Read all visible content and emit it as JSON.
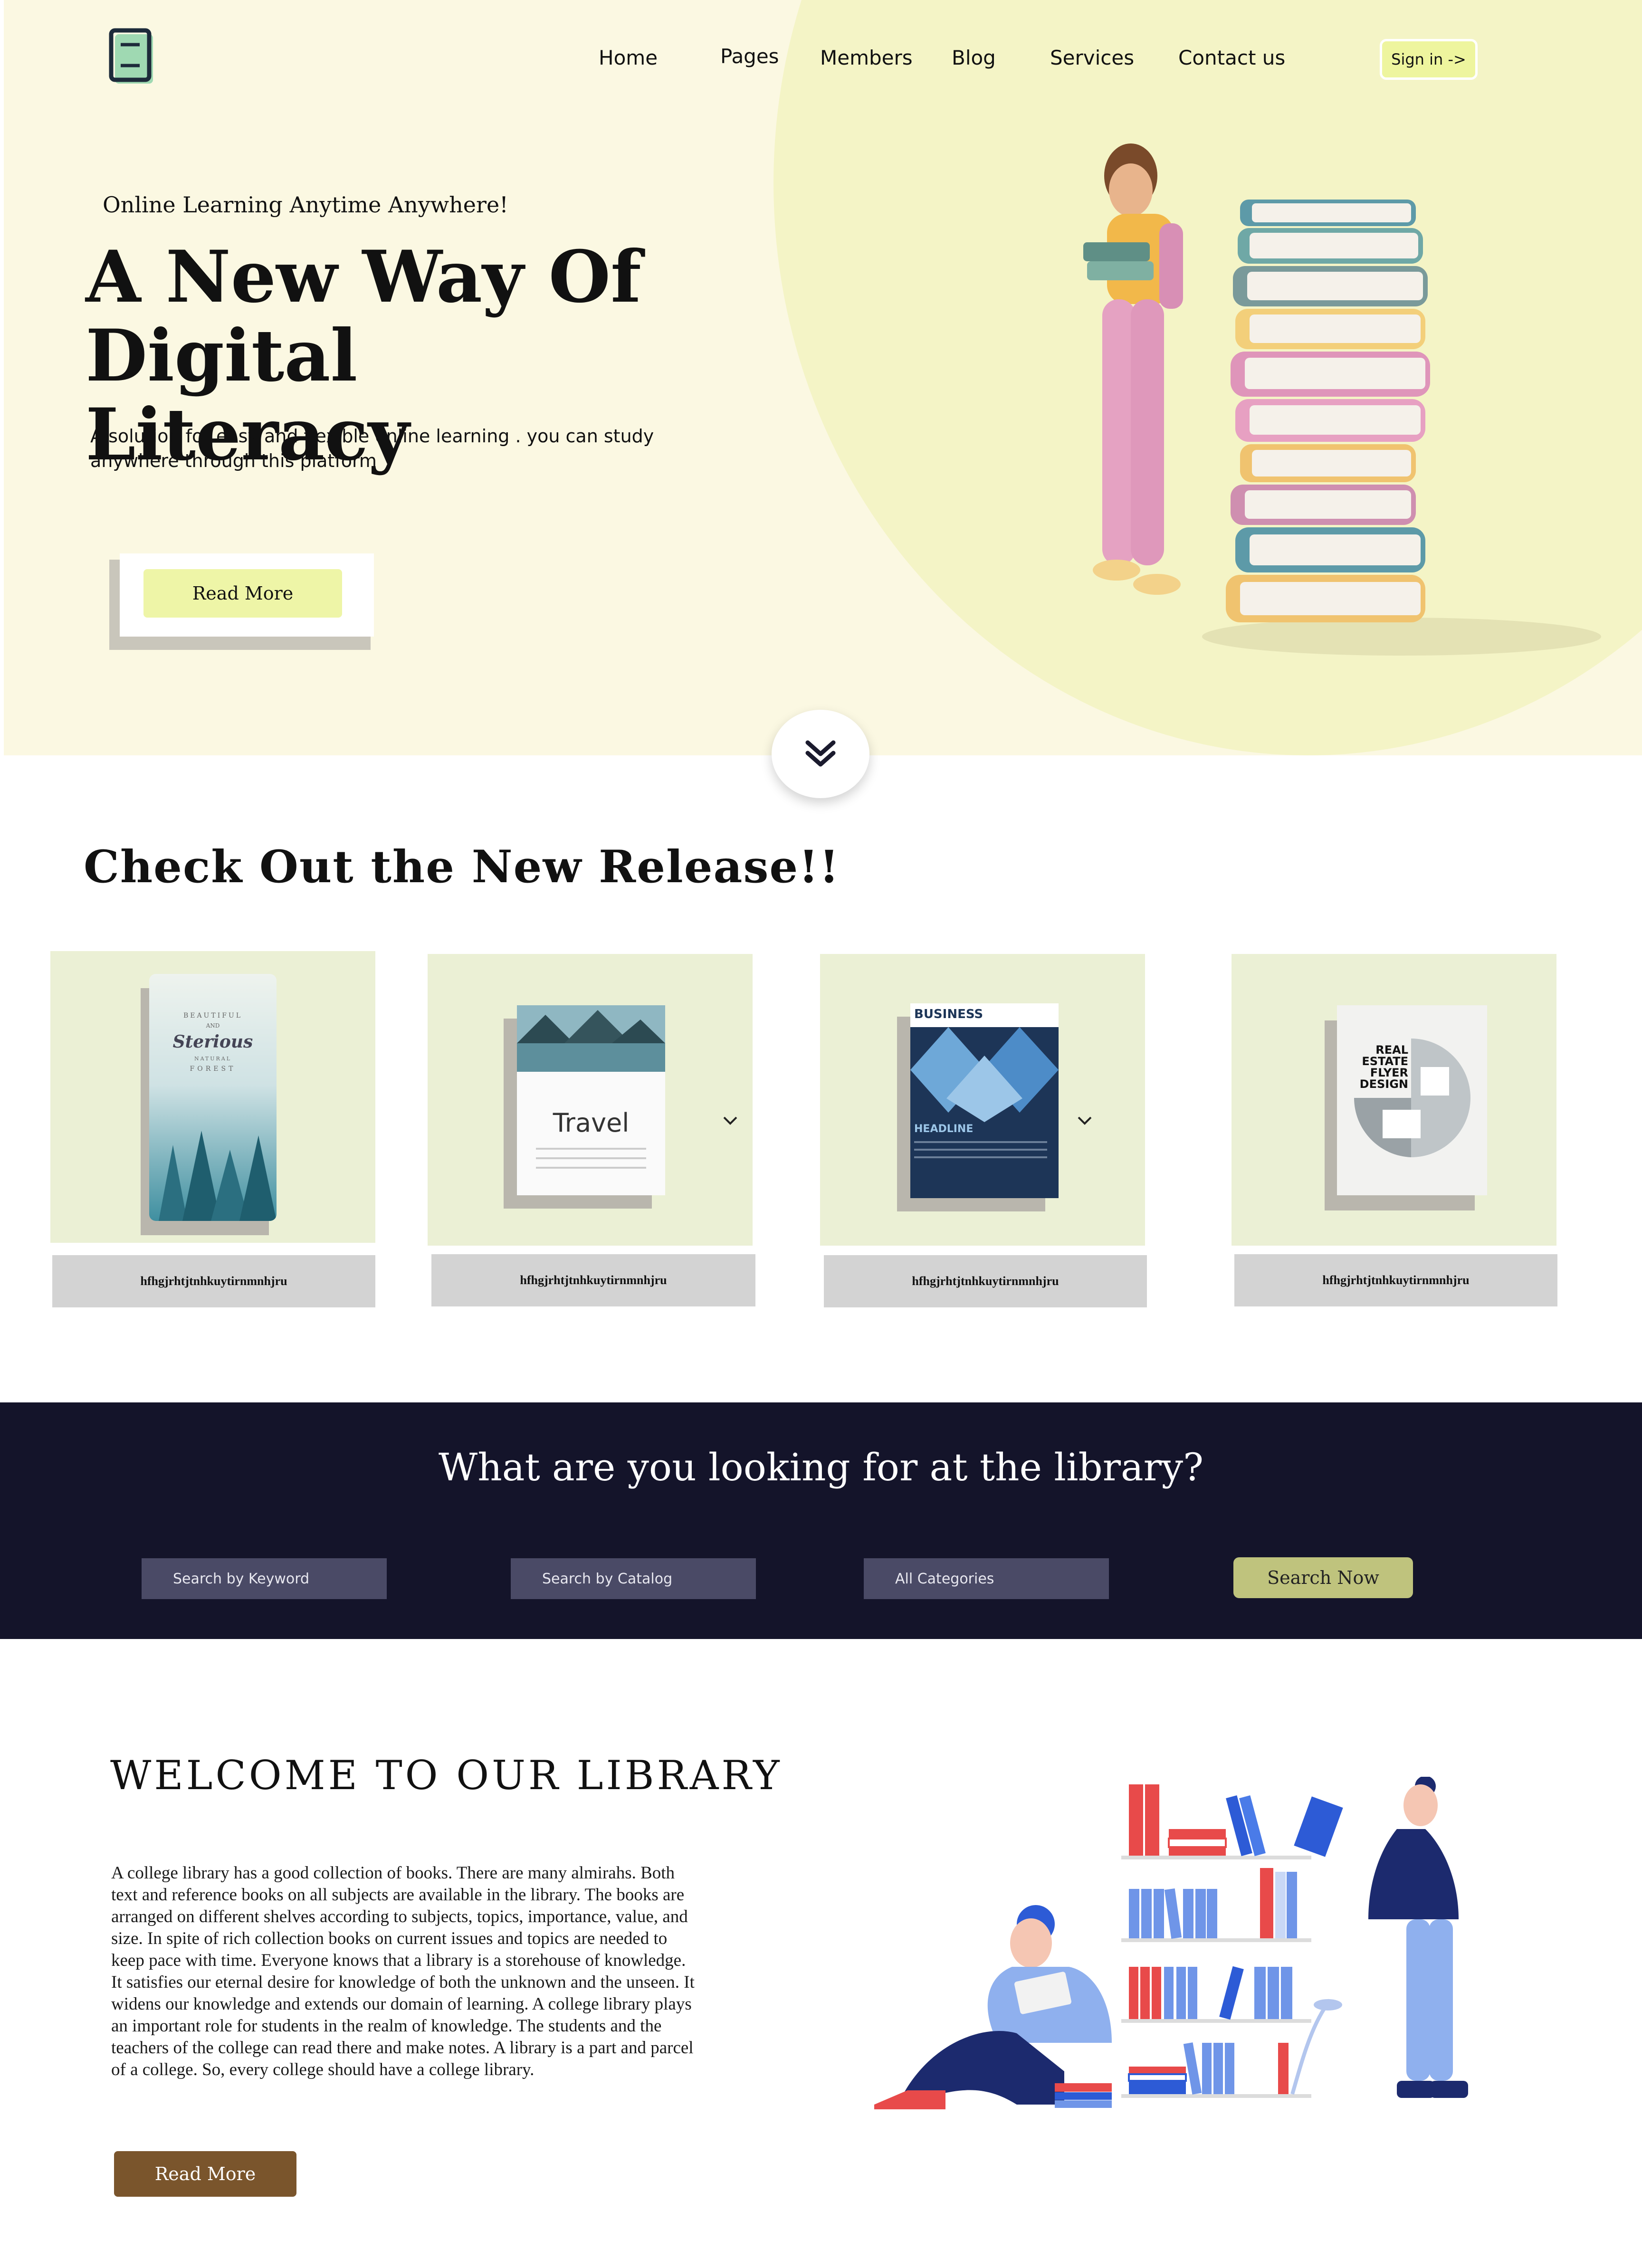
{
  "nav": {
    "logo_icon": "book-logo-icon",
    "links": [
      "Home",
      "Pages",
      "Members",
      "Blog",
      "Services",
      "Contact us"
    ],
    "signin_label": "Sign in ->"
  },
  "hero": {
    "tagline": "Online Learning Anytime Anywhere!",
    "title": "A New Way  Of\nDigital Literacy",
    "description": "A solution for easy and flexible online learning . you can study anywhere through this platform",
    "read_more_label": "Read More",
    "scroll_icon": "double-chevron-down-icon"
  },
  "release": {
    "title": "Check Out the New Release!!",
    "books": [
      {
        "cover_line1": "BEAUTIFUL",
        "cover_line2": "AND",
        "cover_title": "Sterious",
        "cover_line3": "NATURAL",
        "cover_line4": "FOREST",
        "caption": "hfhgjrhtjtnhkuytirnmnhjru"
      },
      {
        "cover_title": "Travel",
        "caption": "hfhgjrhtjtnhkuytirnmnhjru"
      },
      {
        "cover_title": "BUSINESS",
        "cover_sub": "HEADLINE",
        "caption": "hfhgjrhtjtnhkuytirnmnhjru"
      },
      {
        "cover_title": "REAL ESTATE FLYER DESIGN",
        "caption": "hfhgjrhtjtnhkuytirnmnhjru"
      }
    ]
  },
  "search": {
    "heading": "What are you looking for at the library?",
    "keyword_placeholder": "Search by Keyword",
    "catalog_placeholder": "Search by Catalog",
    "category_value": "All Categories",
    "button_label": "Search Now"
  },
  "welcome": {
    "title": "WELCOME TO OUR LIBRARY",
    "body": "A college library has a good collection of books. There are many almirahs. Both text and reference books on all subjects are available in the library. The books are arranged on different shelves according to subjects, topics, importance, value, and size. In spite of rich collection books on current issues and topics are needed to keep pace with time. Everyone knows that a library is a storehouse of knowledge. It satisfies our eternal desire for knowledge of both the unknown and the unseen. It widens our knowledge and extends our domain of learning. A college library plays an important role for students in the realm of knowledge. The students and the teachers of the college can read there and make notes. A library is a part and parcel of a college. So, every college should have a college library.",
    "button_label": "Read More"
  },
  "colors": {
    "hero_bg": "#fbf8e2",
    "accent_yellow": "#eef59e",
    "band_dark": "#14142a",
    "search_btn": "#bfc37d",
    "welcome_btn": "#7a552c"
  }
}
